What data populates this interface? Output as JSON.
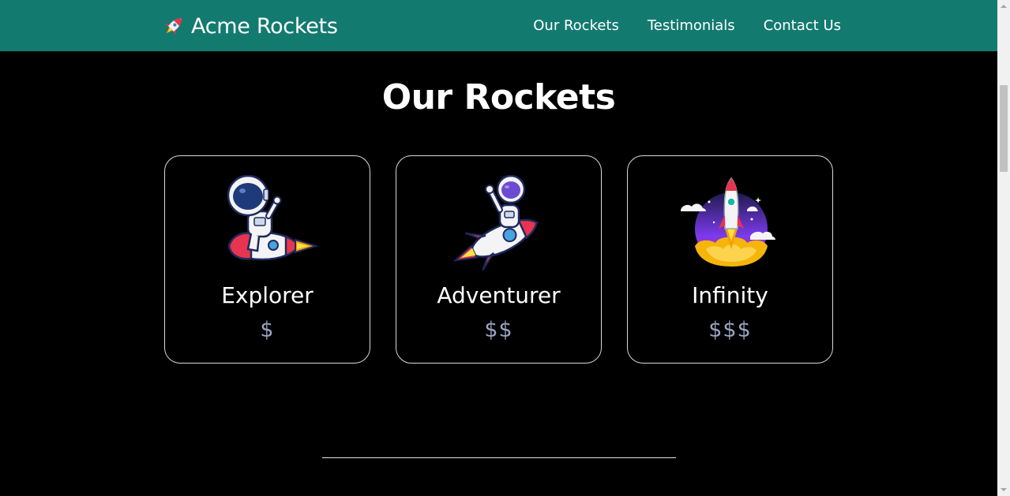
{
  "navbar": {
    "brand": "Acme Rockets",
    "brand_icon": "rocket-icon",
    "links": [
      "Our Rockets",
      "Testimonials",
      "Contact Us"
    ],
    "background": "#137a70"
  },
  "main": {
    "title": "Our Rockets",
    "cards": [
      {
        "name": "Explorer",
        "price": "$",
        "illustration": "astronaut-riding-rocket-illustration"
      },
      {
        "name": "Adventurer",
        "price": "$$",
        "illustration": "astronaut-waving-on-rocket-illustration"
      },
      {
        "name": "Infinity",
        "price": "$$$",
        "illustration": "rocket-launch-illustration"
      }
    ]
  },
  "colors": {
    "background": "#000000",
    "accent": "#137a70",
    "price": "#9aa4c3",
    "card_border": "#d9d9d9"
  }
}
